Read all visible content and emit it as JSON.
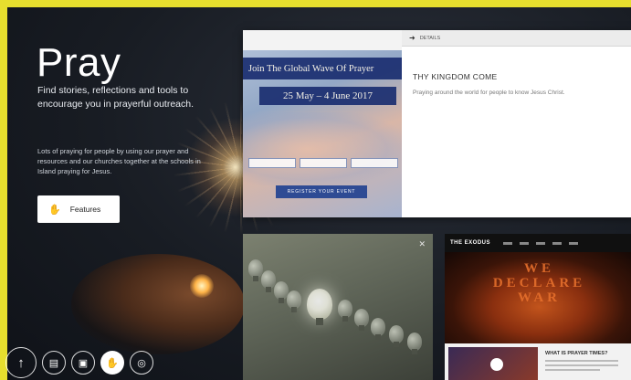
{
  "hero": {
    "title": "Pray",
    "intro": "Find stories, reflections and tools to encourage you in prayerful outreach.",
    "body": "Lots of praying for people by using our prayer and resources and our churches together at the schools in Island praying for Jesus.",
    "features_button": "Features",
    "features_icon": "hand-icon"
  },
  "bottom_nav": [
    {
      "name": "up-arrow-icon",
      "glyph": "↑"
    },
    {
      "name": "book-icon",
      "glyph": "▤"
    },
    {
      "name": "chat-icon",
      "glyph": "▣"
    },
    {
      "name": "hand-icon",
      "glyph": "✋"
    },
    {
      "name": "compass-icon",
      "glyph": "◎"
    }
  ],
  "card_top": {
    "banner": "Join The Global Wave Of Prayer",
    "dates": "25 May – 4 June 2017",
    "cta": "REGISTER YOUR EVENT",
    "tab_label": "DETAILS",
    "heading": "THY KINGDOM COME",
    "description": "Praying around the world for people to know Jesus Christ."
  },
  "card_war": {
    "logo": "THE EXODUS",
    "headline_line1": "WE",
    "headline_line2": "DECLARE",
    "headline_line3": "WAR",
    "sub_heading": "WHAT IS PRAYER TIMES?"
  },
  "colors": {
    "border": "#e7df2e",
    "banner_blue": "#1a2e70",
    "fire_orange": "#e56f2c"
  }
}
